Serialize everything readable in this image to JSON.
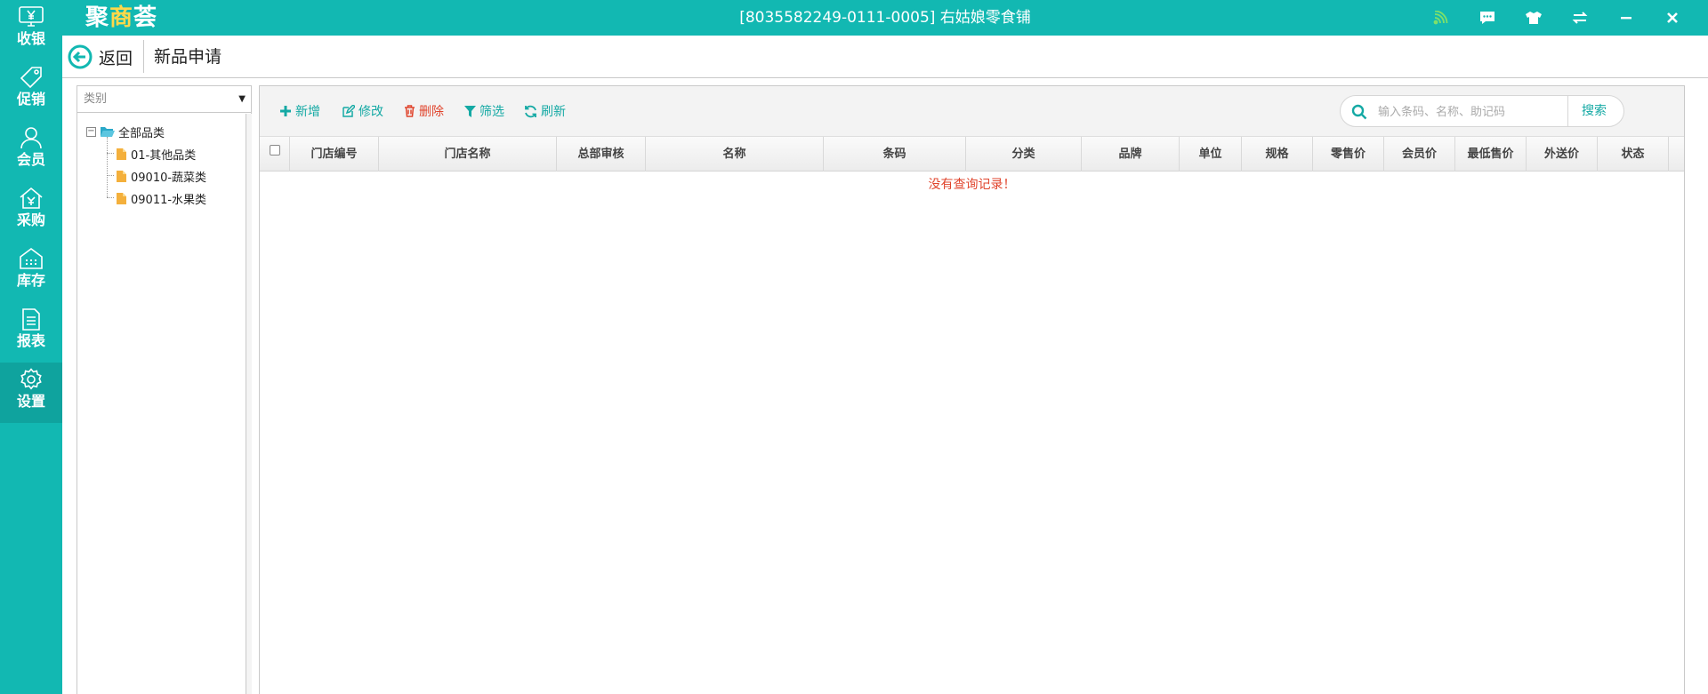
{
  "app": {
    "logo": {
      "part1": "聚",
      "part2": "商",
      "part3": "荟"
    },
    "window_title": "[8035582249-0111-0005] 右姑娘零食铺",
    "titlebar_icons": [
      "signal-icon",
      "message-icon",
      "skin-icon",
      "switch-icon",
      "minimize-icon",
      "close-icon"
    ]
  },
  "nav": {
    "items": [
      {
        "label": "收银",
        "icon": "cash-register-icon"
      },
      {
        "label": "促销",
        "icon": "tag-icon"
      },
      {
        "label": "会员",
        "icon": "user-icon"
      },
      {
        "label": "采购",
        "icon": "purchase-icon"
      },
      {
        "label": "库存",
        "icon": "warehouse-icon"
      },
      {
        "label": "报表",
        "icon": "report-icon"
      },
      {
        "label": "设置",
        "icon": "gear-icon"
      }
    ],
    "active_index": 6
  },
  "header": {
    "back_label": "返回",
    "page_title": "新品申请"
  },
  "category": {
    "select_value": "类别",
    "tree": {
      "root": {
        "label": "全部品类",
        "expanded": true
      },
      "children": [
        {
          "label": "01-其他品类"
        },
        {
          "label": "09010-蔬菜类"
        },
        {
          "label": "09011-水果类"
        }
      ]
    }
  },
  "toolbar": {
    "add_label": "新增",
    "edit_label": "修改",
    "delete_label": "删除",
    "filter_label": "筛选",
    "refresh_label": "刷新",
    "search_placeholder": "输入条码、名称、助记码",
    "search_button": "搜索"
  },
  "grid": {
    "columns": [
      "门店编号",
      "门店名称",
      "总部审核",
      "名称",
      "条码",
      "分类",
      "品牌",
      "单位",
      "规格",
      "零售价",
      "会员价",
      "最低售价",
      "外送价",
      "状态"
    ],
    "rows": [],
    "empty_message": "没有查询记录！"
  },
  "colors": {
    "brand": "#12b8b2",
    "toolbar_text": "#14a9a4",
    "danger": "#e0442c",
    "folder": "#f4b03c"
  }
}
